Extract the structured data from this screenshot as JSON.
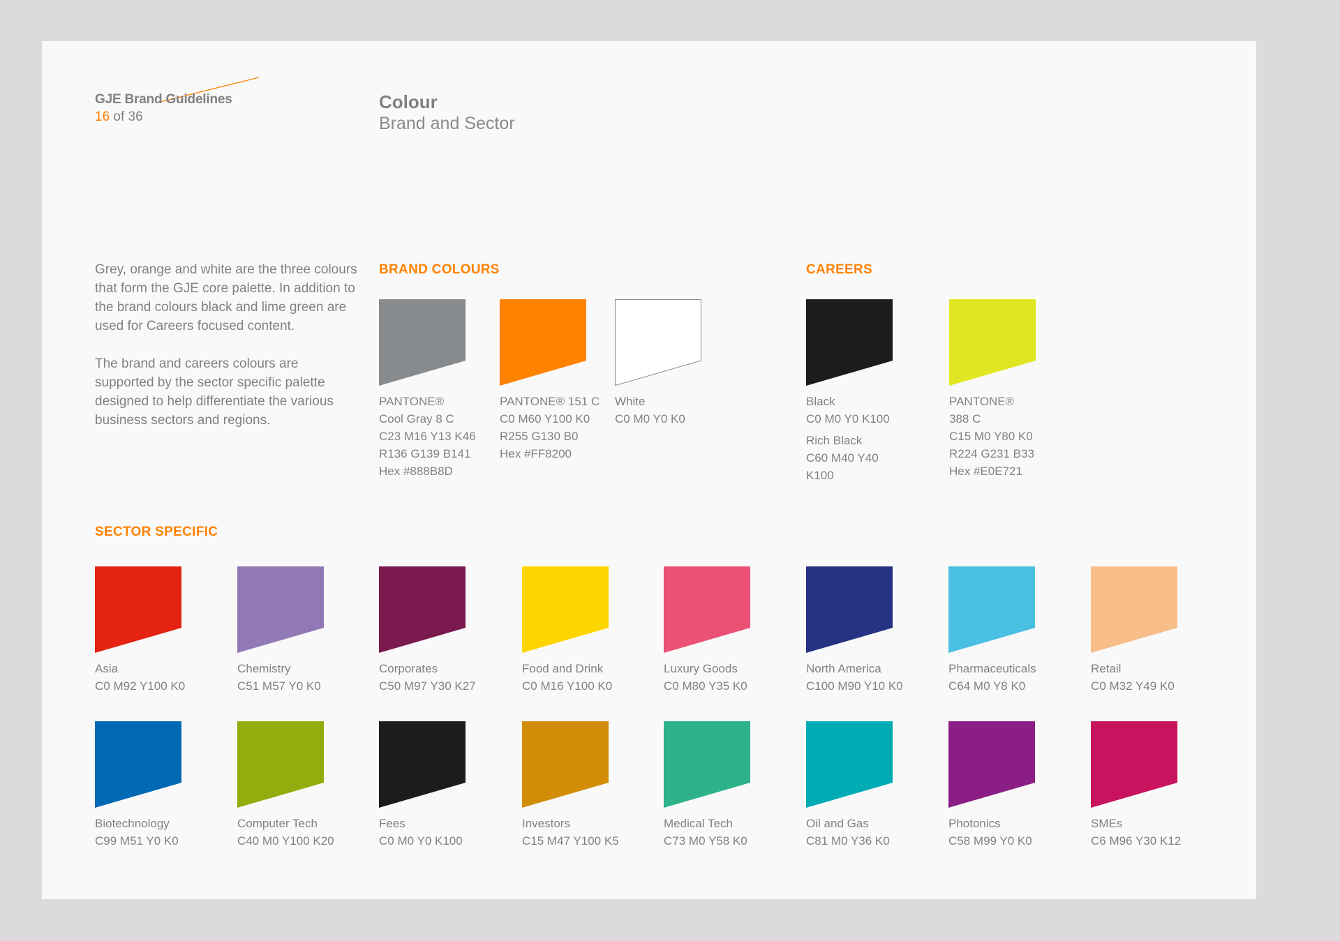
{
  "header": {
    "doc_title": "GJE Brand Guidelines",
    "page_current": "16",
    "page_of": "of 36",
    "accent": "#ff8200"
  },
  "section": {
    "title": "Colour",
    "subtitle": "Brand and Sector"
  },
  "intro": {
    "p1": "Grey, orange and white are the three colours that form the GJE core palette. In addition to the brand colours black and lime green are used for Careers focused content.",
    "p2": "The brand and careers colours are supported by the sector specific palette designed to help differentiate the various business sectors and regions."
  },
  "brand": {
    "heading": "BRAND COLOURS",
    "swatches": [
      {
        "color": "#888B8D",
        "lines": [
          "PANTONE®",
          "Cool Gray 8 C",
          "C23 M16 Y13 K46",
          "R136 G139 B141",
          "Hex #888B8D"
        ]
      },
      {
        "color": "#FF8200",
        "lines": [
          "PANTONE® 151 C",
          "C0 M60 Y100 K0",
          "R255 G130 B0",
          "Hex #FF8200"
        ]
      },
      {
        "color": "#FFFFFF",
        "outline": true,
        "lines": [
          "White",
          "C0 M0 Y0 K0"
        ]
      }
    ]
  },
  "careers": {
    "heading": "CAREERS",
    "swatches": [
      {
        "color": "#1C1C1B",
        "lines": [
          "Black",
          "C0 M0 Y0 K100"
        ],
        "lines2": [
          "Rich Black",
          "C60 M40 Y40",
          "K100"
        ]
      },
      {
        "color": "#E0E721",
        "lines": [
          "PANTONE®",
          "388 C",
          "C15 M0 Y80 K0",
          "R224 G231 B33",
          "Hex #E0E721"
        ]
      }
    ]
  },
  "sector": {
    "heading": "SECTOR SPECIFIC",
    "rows": [
      [
        {
          "name": "Asia",
          "cmyk": "C0 M92 Y100 K0",
          "color": "#E42313"
        },
        {
          "name": "Chemistry",
          "cmyk": "C51 M57 Y0 K0",
          "color": "#9179B6"
        },
        {
          "name": "Corporates",
          "cmyk": "C50 M97 Y30 K27",
          "color": "#7A1A4F"
        },
        {
          "name": "Food and Drink",
          "cmyk": "C0 M16 Y100 K0",
          "color": "#FFD500"
        },
        {
          "name": "Luxury Goods",
          "cmyk": "C0 M80 Y35 K0",
          "color": "#EA5174"
        },
        {
          "name": "North America",
          "cmyk": "C100 M90 Y10 K0",
          "color": "#263283"
        },
        {
          "name": "Pharmaceuticals",
          "cmyk": "C64 M0 Y8 K0",
          "color": "#49BFE2"
        },
        {
          "name": "Retail",
          "cmyk": "C0 M32 Y49 K0",
          "color": "#F8BE8A"
        }
      ],
      [
        {
          "name": "Biotechnology",
          "cmyk": "C99 M51 Y0 K0",
          "color": "#0068B4"
        },
        {
          "name": "Computer Tech",
          "cmyk": "C40 M0 Y100 K20",
          "color": "#93AC0E"
        },
        {
          "name": "Fees",
          "cmyk": "C0 M0 Y0 K100",
          "color": "#1C1C1B"
        },
        {
          "name": "Investors",
          "cmyk": "C15 M47 Y100 K5",
          "color": "#D18C08"
        },
        {
          "name": "Medical Tech",
          "cmyk": "C73 M0 Y58 K0",
          "color": "#2DB28A"
        },
        {
          "name": "Oil and Gas",
          "cmyk": "C81 M0 Y36 K0",
          "color": "#00ABB4"
        },
        {
          "name": "Photonics",
          "cmyk": "C58 M99 Y0 K0",
          "color": "#8A1E85"
        },
        {
          "name": "SMEs",
          "cmyk": "C6 M96 Y30 K12",
          "color": "#C8135E"
        }
      ]
    ]
  }
}
